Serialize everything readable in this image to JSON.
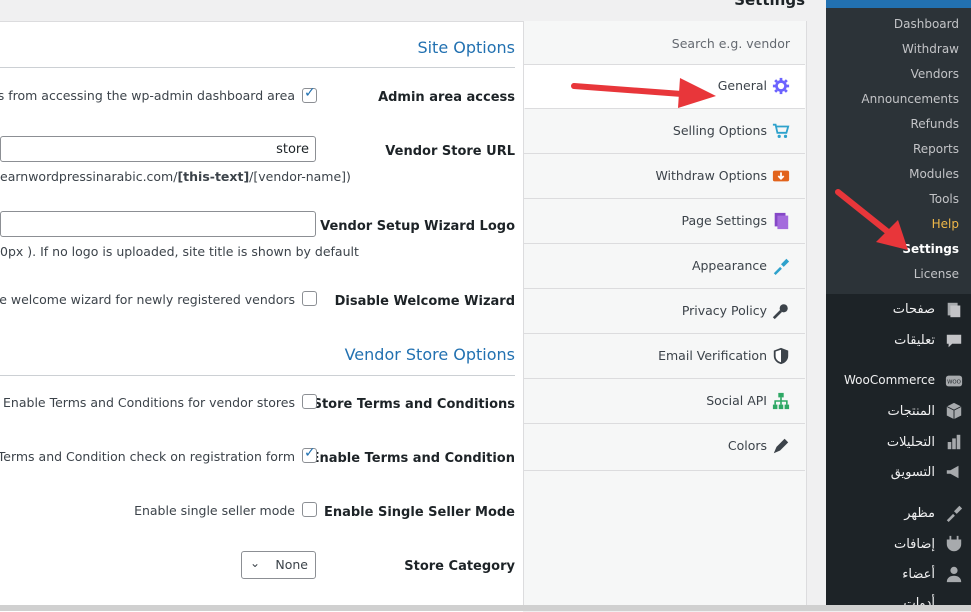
{
  "page": {
    "title": "Settings"
  },
  "site_options": {
    "title": "Site Options",
    "admin_access": {
      "label": "Admin area access",
      "desc": "tomers from accessing the wp-admin dashboard area",
      "checked": true
    },
    "store_url": {
      "label": "Vendor Store URL",
      "value": "store",
      "desc_pre": "earnwordpressinarabic.com/",
      "desc_bold": "[this-text]",
      "desc_post": "/[vendor-name])"
    },
    "wizard_logo": {
      "label": "Vendor Setup Wizard Logo",
      "value": "",
      "desc": "0px ). If no logo is uploaded, site title is shown by default"
    },
    "welcome_wizard": {
      "label": "Disable Welcome Wizard",
      "desc": "Disable welcome wizard for newly registered vendors",
      "checked": false
    }
  },
  "vendor_store_options": {
    "title": "Vendor Store Options",
    "terms": {
      "label": "Store Terms and Conditions",
      "desc": "Enable Terms and Conditions for vendor stores",
      "checked": false
    },
    "terms_check": {
      "label": "Enable Terms and Condition",
      "desc": "nable Terms and Condition check on registration form",
      "checked": true
    },
    "single_seller": {
      "label": "Enable Single Seller Mode",
      "desc": "Enable single seller mode",
      "checked": false
    },
    "store_category": {
      "label": "Store Category",
      "selected": "None"
    }
  },
  "tabs": {
    "search_placeholder": "Search e.g. vendor",
    "items": [
      {
        "label": "General",
        "icon": "gear-icon",
        "color": "#6c63ff"
      },
      {
        "label": "Selling Options",
        "icon": "cart-icon",
        "color": "#2ea2cc"
      },
      {
        "label": "Withdraw Options",
        "icon": "withdraw-icon",
        "color": "#e2631b"
      },
      {
        "label": "Page Settings",
        "icon": "pages-icon",
        "color": "#8548c7"
      },
      {
        "label": "Appearance",
        "icon": "brush-icon",
        "color": "#2ea2cc"
      },
      {
        "label": "Privacy Policy",
        "icon": "key-icon",
        "color": "#3c434a"
      },
      {
        "label": "Email Verification",
        "icon": "shield-icon",
        "color": "#3c434a"
      },
      {
        "label": "Social API",
        "icon": "sitemap-icon",
        "color": "#2ea865"
      },
      {
        "label": "Colors",
        "icon": "pencil-icon",
        "color": "#3c434a"
      }
    ]
  },
  "sidebar": {
    "submenu": [
      "Dashboard",
      "Withdraw",
      "Vendors",
      "Announcements",
      "Refunds",
      "Reports",
      "Modules",
      "Tools",
      "Help",
      "Settings",
      "License"
    ],
    "menu": [
      {
        "label": "صفحات",
        "icon": "pages-icon"
      },
      {
        "label": "تعليقات",
        "icon": "comment-icon"
      },
      {
        "label": "WooCommerce",
        "icon": "woo-icon"
      },
      {
        "label": "المنتجات",
        "icon": "box-icon"
      },
      {
        "label": "التحليلات",
        "icon": "bar-chart-icon"
      },
      {
        "label": "التسويق",
        "icon": "megaphone-icon"
      },
      {
        "label": "مظهر",
        "icon": "brush-icon"
      },
      {
        "label": "إضافات",
        "icon": "plugin-icon"
      },
      {
        "label": "أعضاء",
        "icon": "user-icon"
      },
      {
        "label": "أدوات",
        "icon": "wrench-icon"
      }
    ]
  },
  "colors": {
    "accent": "#2271b1",
    "sidebar": "#1d2327",
    "arrow": "#e8363a"
  }
}
